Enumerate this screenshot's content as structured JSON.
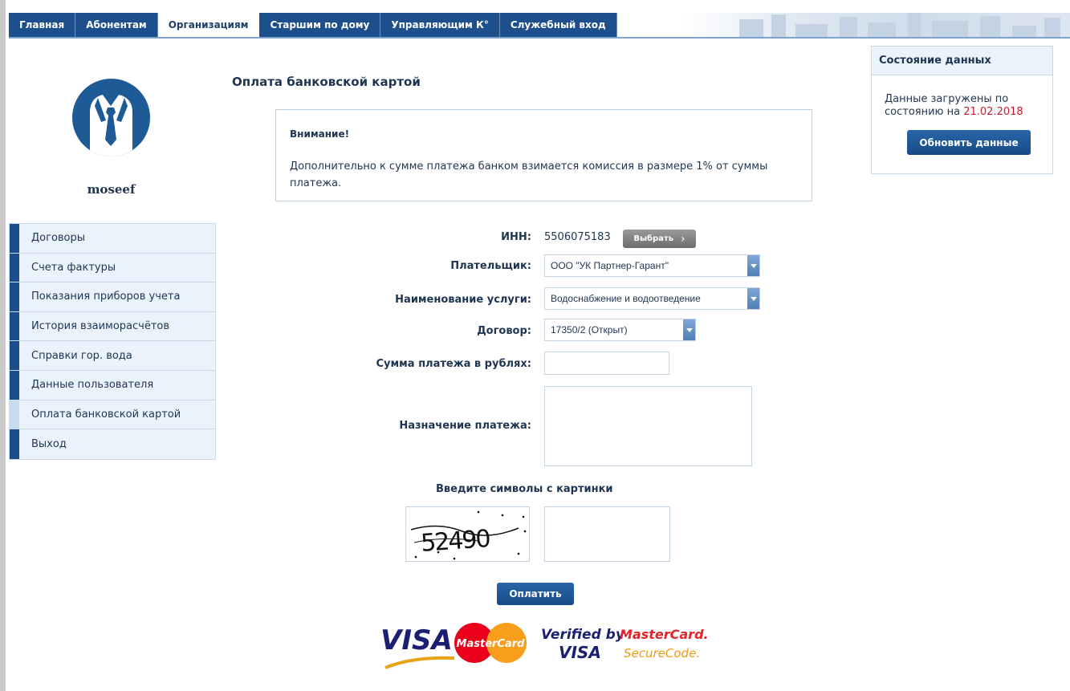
{
  "nav": {
    "tabs": [
      {
        "label": "Главная",
        "active": false
      },
      {
        "label": "Абонентам",
        "active": false
      },
      {
        "label": "Организациям",
        "active": true
      },
      {
        "label": "Старшим по дому",
        "active": false
      },
      {
        "label": "Управляющим К°",
        "active": false
      },
      {
        "label": "Служебный вход",
        "active": false
      }
    ]
  },
  "profile": {
    "username": "moseef",
    "avatar_icon": "suit-tie-icon"
  },
  "sidebar": {
    "items": [
      {
        "label": "Договоры",
        "active": false
      },
      {
        "label": "Счета фактуры",
        "active": false
      },
      {
        "label": "Показания приборов учета",
        "active": false
      },
      {
        "label": "История взаиморасчётов",
        "active": false
      },
      {
        "label": "Справки гор. вода",
        "active": false
      },
      {
        "label": "Данные пользователя",
        "active": false
      },
      {
        "label": "Оплата банковской картой",
        "active": true
      },
      {
        "label": "Выход",
        "active": false
      }
    ]
  },
  "main": {
    "title": "Оплата банковской картой",
    "notice": {
      "title": "Внимание!",
      "text": "Дополнительно к сумме платежа банком взимается комиссия в размере 1% от суммы платежа."
    },
    "form": {
      "inn_label": "ИНН:",
      "inn_value": "5506075183",
      "pick_button": "Выбрать",
      "payer_label": "Плательщик:",
      "payer_value": "ООО \"УК Партнер-Гарант\"",
      "service_label": "Наименование услуги:",
      "service_value": "Водоснабжение и водоотведение",
      "contract_label": "Договор:",
      "contract_value": "17350/2 (Открыт)",
      "amount_label": "Сумма платежа в рублях:",
      "amount_value": "",
      "purpose_label": "Назначение платежа:",
      "purpose_value": "",
      "captcha_label": "Введите символы с картинки",
      "captcha_text": "52490",
      "captcha_value": "",
      "pay_button": "Оплатить"
    },
    "logos": {
      "visa": "VISA",
      "mastercard": "MasterCard",
      "verified_by": "Verified by",
      "verified_visa": "VISA",
      "mc_secure_1": "MasterCard.",
      "mc_secure_2": "SecureCode."
    }
  },
  "state": {
    "title": "Состояние данных",
    "text": "Данные загружены по состоянию на",
    "date": "21.02.2018",
    "refresh_button": "Обновить данные"
  },
  "colors": {
    "nav": "#1c4f8c",
    "accent_date": "#c61a2e",
    "sidebar_bg": "#eaf3fb"
  }
}
